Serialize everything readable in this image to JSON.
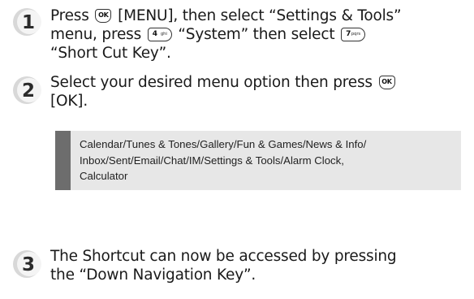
{
  "steps": [
    {
      "number": "1",
      "lines": {
        "l1_a": "Press",
        "l1_key": "OK",
        "l1_b": "[MENU], then select “Settings & Tools”",
        "l2_a": "menu, press",
        "l2_key_num": "4",
        "l2_key_sub": "ghi",
        "l2_b": "“System” then select",
        "l2_key2_num": "7",
        "l2_key2_sub": "pqrs",
        "l3": "“Short Cut Key”."
      }
    },
    {
      "number": "2",
      "lines": {
        "l1_a": "Select your desired menu option then press",
        "l1_key": "OK",
        "l2": "[OK]."
      }
    },
    {
      "number": "3",
      "lines": {
        "l1": "The Shortcut can now be accessed by pressing",
        "l2": "the “Down Navigation Key”."
      }
    }
  ],
  "note": {
    "line1": "Calendar/Tunes & Tones/Gallery/Fun & Games/News & Info/",
    "line2": "Inbox/Sent/Email/Chat/IM/Settings & Tools/Alarm Clock,",
    "line3": "Calculator"
  },
  "colors": {
    "badge_dark": "#2b2b2b",
    "badge_light": "#d8d8d8",
    "note_bar": "#6d6d6d",
    "note_bg": "#e7e7e7"
  }
}
